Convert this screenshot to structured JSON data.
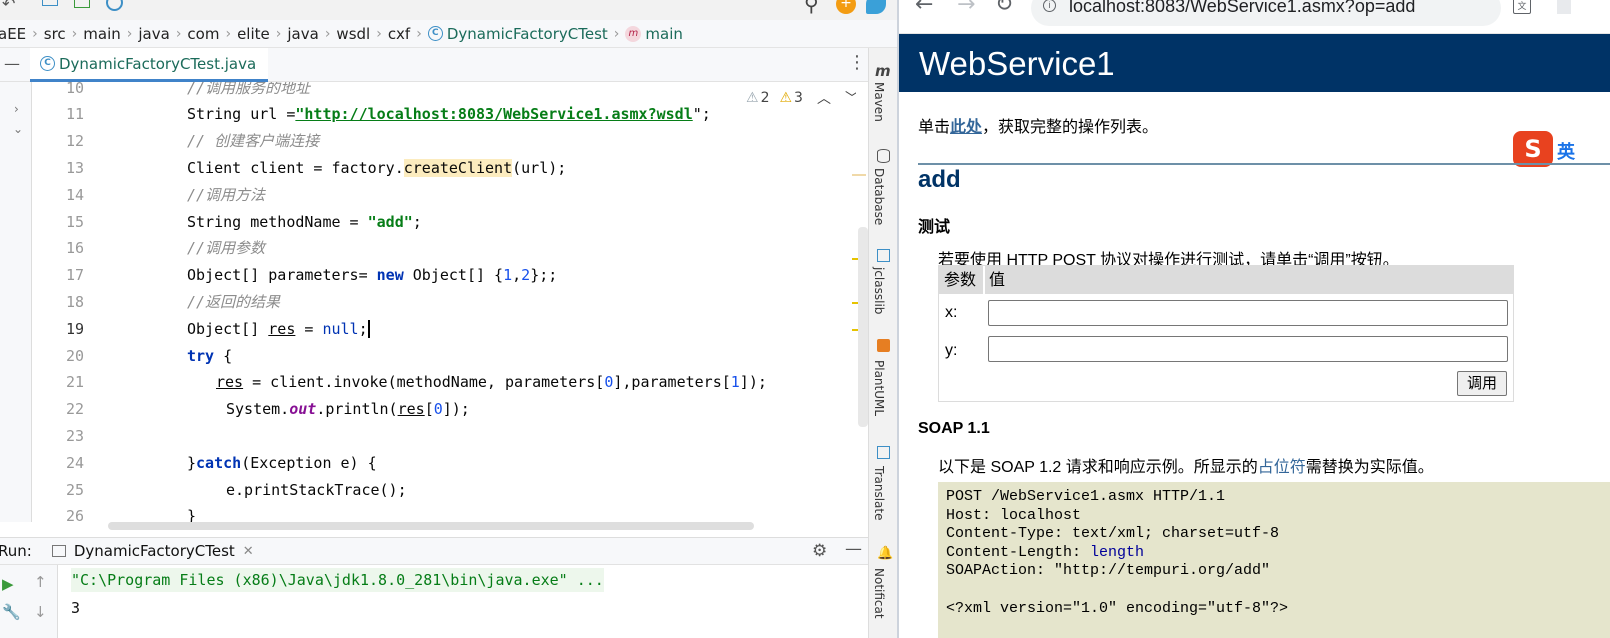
{
  "ide": {
    "breadcrumbs": [
      "aEE",
      "src",
      "main",
      "java",
      "com",
      "elite",
      "java",
      "wsdl",
      "cxf",
      "DynamicFactoryCTest",
      "main"
    ],
    "file_tab": "DynamicFactoryCTest.java",
    "inspection": {
      "warn_a": "2",
      "warn_b": "3"
    },
    "lines": [
      {
        "n": "10",
        "text": "//调用服务的地址"
      },
      {
        "n": "11",
        "pre": "String url =",
        "str": "\"http://localhost:8083/WebService1.asmx?wsdl",
        "post": "\";"
      },
      {
        "n": "12",
        "text": "// 创建客户端连接"
      },
      {
        "n": "13",
        "pre": "Client client = factory.",
        "call": "createClient",
        "post": "(url);"
      },
      {
        "n": "14",
        "text": "//调用方法"
      },
      {
        "n": "15",
        "pre": "String methodName = ",
        "str": "\"add\"",
        "post": ";"
      },
      {
        "n": "16",
        "text": "//调用参数"
      },
      {
        "n": "17",
        "pre": "Object[] parameters= ",
        "kw": "new",
        "mid": " Object[] {",
        "n1": "1",
        "c": ",",
        "n2": "2",
        "post": "};;"
      },
      {
        "n": "18",
        "text": "//返回的结果"
      },
      {
        "n": "19",
        "pre": "Object[] ",
        "var": "res",
        "mid": " = ",
        "kw": "null",
        "post": ";"
      },
      {
        "n": "20",
        "kw": "try",
        "post": " {"
      },
      {
        "n": "21",
        "var": "res",
        "pre": " = client.invoke(methodName, parameters[",
        "n1": "0",
        "mid": "],parameters[",
        "n2": "1",
        "post": "]);"
      },
      {
        "n": "22",
        "pre": "System.",
        "fld": "out",
        "mid": ".println(",
        "var": "res",
        "mid2": "[",
        "n1": "0",
        "post": "]);"
      },
      {
        "n": "23",
        "text": ""
      },
      {
        "n": "24",
        "pre": "}",
        "kw": "catch",
        "post": "(Exception e) {"
      },
      {
        "n": "25",
        "pre": "e.printStackTrace();"
      },
      {
        "n": "26",
        "pre": "}"
      }
    ],
    "side_tabs": [
      "Maven",
      "Database",
      "jclasslib",
      "PlantUML",
      "Translate",
      "Notificat"
    ],
    "run_label": "Run:",
    "run_tab": "DynamicFactoryCTest",
    "console": [
      "\"C:\\Program Files (x86)\\Java\\jdk1.8.0_281\\bin\\java.exe\" ...",
      "3"
    ]
  },
  "browser": {
    "url": "localhost:8083/WebService1.asmx?op=add",
    "service_title": "WebService1",
    "intro_pre": "单击",
    "intro_link": "此处",
    "intro_post": "，获取完整的操作列表。",
    "op_name": "add",
    "test_heading": "测试",
    "test_desc": "若要使用 HTTP POST 协议对操作进行测试，请单击“调用”按钮。",
    "param_header": "参数",
    "value_header": "值",
    "param_x": "x:",
    "param_y": "y:",
    "invoke_label": "调用",
    "soap_heading": "SOAP 1.1",
    "soap_desc_pre": "以下是 SOAP 1.2 请求和响应示例。所显示的",
    "soap_desc_link": "占位符",
    "soap_desc_post": "需替换为实际值。",
    "soap_l1": "POST /WebService1.asmx HTTP/1.1",
    "soap_l2": "Host: localhost",
    "soap_l3": "Content-Type: text/xml; charset=utf-8",
    "soap_l4_pre": "Content-Length: ",
    "soap_l4_val": "length",
    "soap_l5": "SOAPAction: \"http://tempuri.org/add\"",
    "soap_l7": "<?xml version=\"1.0\" encoding=\"utf-8\"?>"
  },
  "colors": {
    "banner": "#003366",
    "link": "#336699",
    "soapbox": "#e5e5cc",
    "ide_accent": "#4083c9"
  }
}
